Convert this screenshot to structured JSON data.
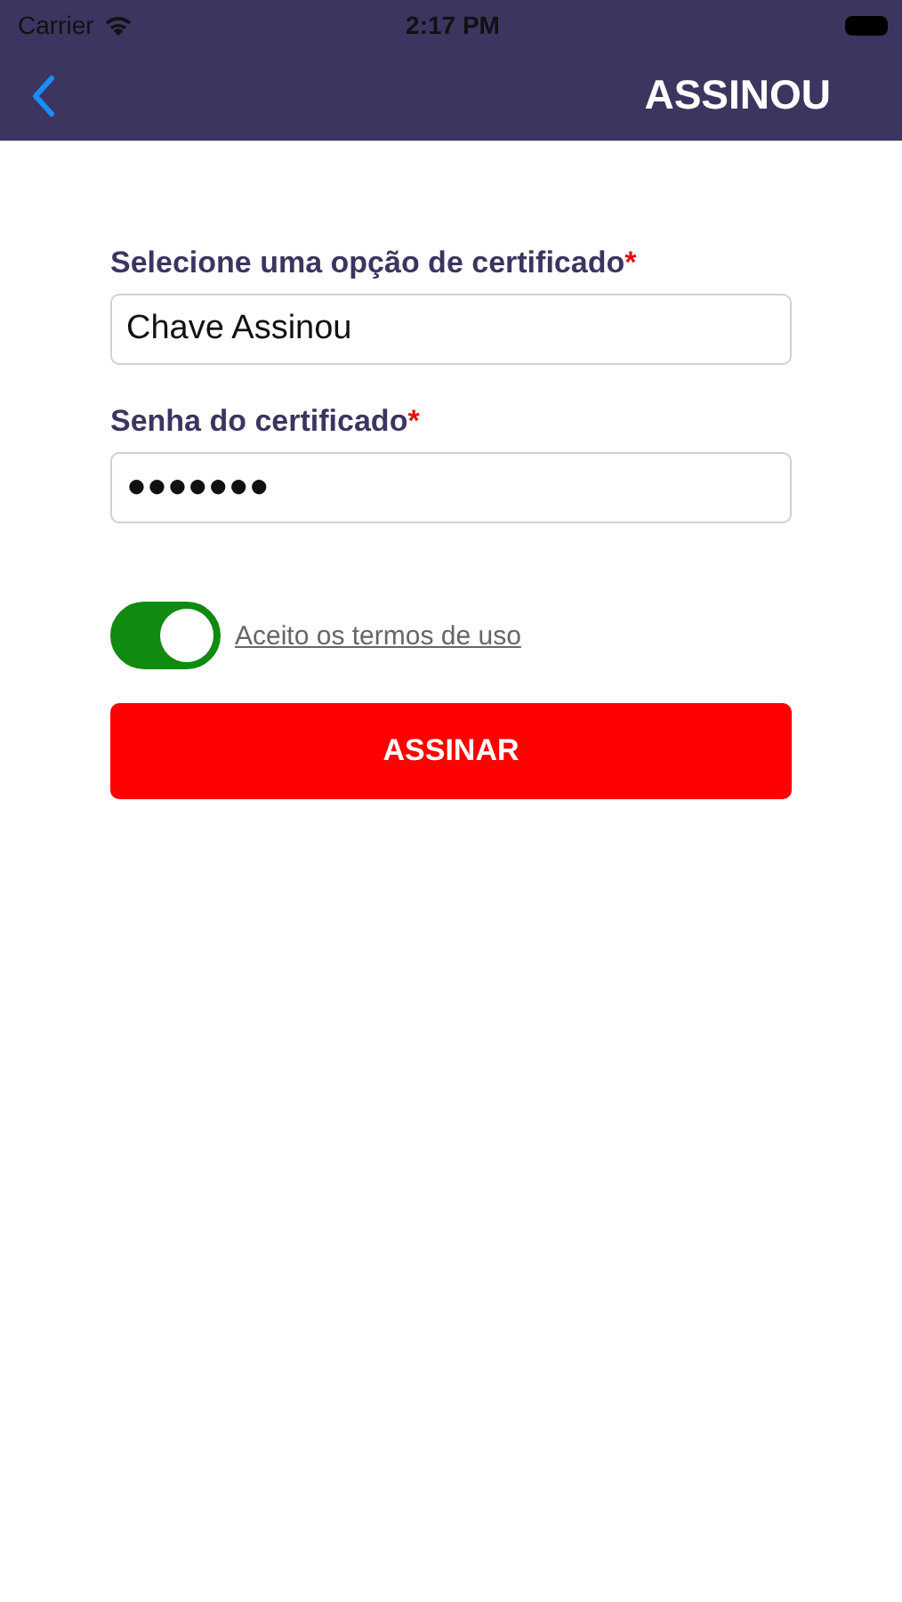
{
  "status_bar": {
    "carrier": "Carrier",
    "time": "2:17 PM"
  },
  "nav_bar": {
    "title": "ASSINOU"
  },
  "fields": [
    {
      "label": "Selecione uma opção de certificado",
      "required_mark": "*",
      "value": "Chave Assinou"
    },
    {
      "label": "Senha do certificado",
      "required_mark": "*",
      "value": "●●●●●●●"
    }
  ],
  "terms": {
    "on": true,
    "label": "Aceito os termos de uso"
  },
  "submit_button": "ASSINAR"
}
